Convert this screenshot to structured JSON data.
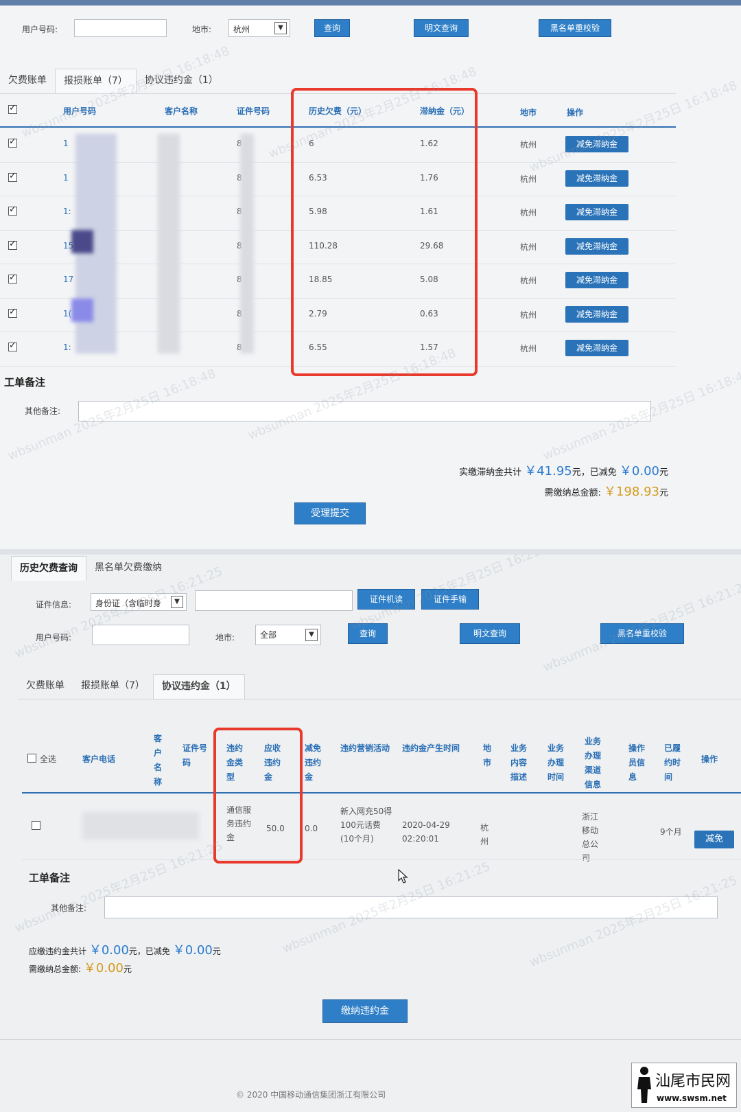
{
  "panel1": {
    "search": {
      "user_label": "用户号码:",
      "city_label": "地市:",
      "city_value": "杭州",
      "query_btn": "查询",
      "plain_query_btn": "明文查询",
      "blacklist_btn": "黑名单重校验"
    },
    "tabs": [
      "欠费账单",
      "报损账单（7）",
      "协议违约金（1）"
    ],
    "columns": [
      "用户号码",
      "客户名称",
      "证件号码",
      "历史欠费（元）",
      "滞纳金（元）",
      "地市",
      "操作"
    ],
    "rows": [
      {
        "user": "1",
        "id": "8",
        "arrears": "6",
        "late_fee": "1.62",
        "city": "杭州",
        "action": "减免滞纳金"
      },
      {
        "user": "1",
        "id": "8",
        "arrears": "6.53",
        "late_fee": "1.76",
        "city": "杭州",
        "action": "减免滞纳金"
      },
      {
        "user": "1:",
        "id": "8",
        "arrears": "5.98",
        "late_fee": "1.61",
        "city": "杭州",
        "action": "减免滞纳金"
      },
      {
        "user": "15",
        "id": "8",
        "arrears": "110.28",
        "late_fee": "29.68",
        "city": "杭州",
        "action": "减免滞纳金"
      },
      {
        "user": "17",
        "id": "8",
        "arrears": "18.85",
        "late_fee": "5.08",
        "city": "杭州",
        "action": "减免滞纳金"
      },
      {
        "user": "1(",
        "id": "8",
        "arrears": "2.79",
        "late_fee": "0.63",
        "city": "杭州",
        "action": "减免滞纳金"
      },
      {
        "user": "1:",
        "id": "8",
        "arrears": "6.55",
        "late_fee": "1.57",
        "city": "杭州",
        "action": "减免滞纳金"
      }
    ],
    "notes_title": "工单备注",
    "notes_label": "其他备注:",
    "summary": {
      "paid_label": "实缴滞纳金共计",
      "paid_amount": "￥41.95",
      "paid_unit": "元，已减免",
      "waived_amount": "￥0.00",
      "waived_unit": "元",
      "total_label": "需缴纳总金额:",
      "total_amount": "￥198.93",
      "total_unit": "元"
    },
    "submit_btn": "受理提交"
  },
  "panel2": {
    "top_tabs": [
      "历史欠费查询",
      "黑名单欠费缴纳"
    ],
    "id_label": "证件信息:",
    "id_type": "身份证（含临时身",
    "card_read_btn": "证件机读",
    "card_manual_btn": "证件手输",
    "user_label": "用户号码:",
    "city_label": "地市:",
    "city_value": "全部",
    "query_btn": "查询",
    "plain_query_btn": "明文查询",
    "blacklist_btn": "黑名单重校验",
    "tabs": [
      "欠费账单",
      "报损账单（7）",
      "协议违约金（1）"
    ],
    "select_all": "全选",
    "columns": [
      "客户电话",
      "客户名称",
      "证件号码",
      "违约金类型",
      "应收违约金",
      "减免违约金",
      "违约营销活动",
      "违约金产生时间",
      "地市",
      "业务内容描述",
      "业务办理时间",
      "业务办理渠道信息",
      "操作员信息",
      "已履约时间",
      "操作"
    ],
    "row": {
      "penalty_type": "通信服务违约金",
      "due": "50.0",
      "waived": "0.0",
      "campaign": "新入网充50得100元话费(10个月)",
      "time": "2020-04-29 02:20:01",
      "city": "杭州",
      "channel": "浙江移动总公司",
      "fulfilled": "9个月",
      "action": "减免"
    },
    "notes_title": "工单备注",
    "notes_label": "其他备注:",
    "summary": {
      "due_label": "应缴违约金共计",
      "due_amount": "￥0.00",
      "due_unit": "元，已减免",
      "waived_amount": "￥0.00",
      "waived_unit": "元",
      "total_label": "需缴纳总金额:",
      "total_amount": "￥0.00",
      "total_unit": "元"
    },
    "pay_btn": "缴纳违约金",
    "footer": "© 2020 中国移动通信集团浙江有限公司"
  },
  "watermarks": [
    "wbsunman 2025年2月25日 16:18:48",
    "wbsunman 2025年2月25日 16:21:25"
  ],
  "logo": {
    "name": "汕尾市民网",
    "url": "www.swsm.net"
  },
  "colors": {
    "accent": "#2e7fc7",
    "highlight": "#e8392c",
    "amount_blue": "#2a7bd0",
    "amount_gold": "#d59a1c"
  }
}
